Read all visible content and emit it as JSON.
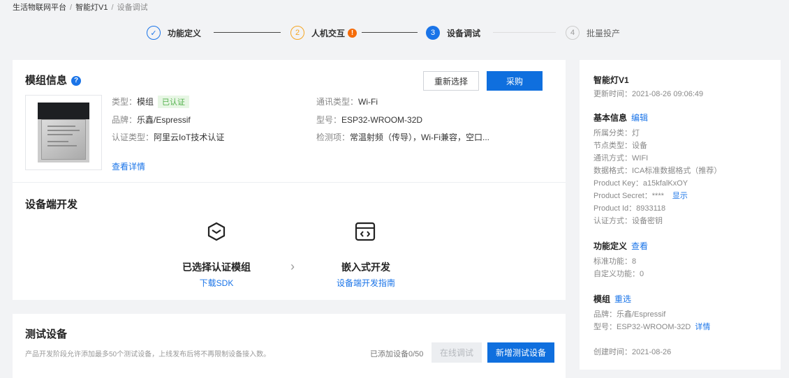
{
  "breadcrumb": {
    "items": [
      "生活物联网平台",
      "智能灯V1",
      "设备调试"
    ]
  },
  "steps": [
    {
      "num": "✓",
      "label": "功能定义"
    },
    {
      "num": "2",
      "label": "人机交互",
      "badge": "!"
    },
    {
      "num": "3",
      "label": "设备调试"
    },
    {
      "num": "4",
      "label": "批量投产"
    }
  ],
  "module": {
    "title": "模组信息",
    "help": "?",
    "reselect_label": "重新选择",
    "purchase_label": "采购",
    "type_key": "类型：",
    "type_val": "模组",
    "cert_badge": "已认证",
    "brand_key": "品牌：",
    "brand_val": "乐鑫/Espressif",
    "cert_key": "认证类型：",
    "cert_val": "阿里云IoT技术认证",
    "comm_key": "通讯类型：",
    "comm_val": "Wi-Fi",
    "model_key": "型号：",
    "model_val": "ESP32-WROOM-32D",
    "detect_key": "检测项：",
    "detect_val": "常温射频（传导），Wi-Fi兼容，空口...",
    "detail_link": "查看详情"
  },
  "device_dev": {
    "title": "设备端开发",
    "step1_title": "已选择认证模组",
    "step1_link": "下载SDK",
    "step2_title": "嵌入式开发",
    "step2_link": "设备端开发指南",
    "chevron": "›"
  },
  "test": {
    "title": "测试设备",
    "desc": "产品开发阶段允许添加最多50个测试设备，上线发布后将不再限制设备接入数。",
    "count": "已添加设备0/50",
    "online_debug_label": "在线调试",
    "add_label": "新增测试设备"
  },
  "panel": {
    "product_name": "智能灯V1",
    "updated": "更新时间：2021-08-26 09:06:49",
    "basic_title": "基本信息",
    "basic_edit": "编辑",
    "category": "所属分类：灯",
    "node_type": "节点类型：设备",
    "comm_method": "通讯方式：WIFI",
    "data_format": "数据格式：ICA标准数据格式（推荐）",
    "product_key": "Product Key：a15kfalKxOY",
    "product_secret": "Product Secret：****",
    "show_link": "显示",
    "product_id": "Product Id：8933118",
    "auth_method": "认证方式：设备密钥",
    "func_title": "功能定义",
    "func_view": "查看",
    "std_func": "标准功能：8",
    "custom_func": "自定义功能：0",
    "mod_title": "模组",
    "mod_reselect": "重选",
    "mod_brand": "品牌：乐鑫/Espressif",
    "mod_model": "型号：ESP32-WROOM-32D",
    "mod_detail": "详情",
    "created": "创建时间：2021-08-26"
  }
}
